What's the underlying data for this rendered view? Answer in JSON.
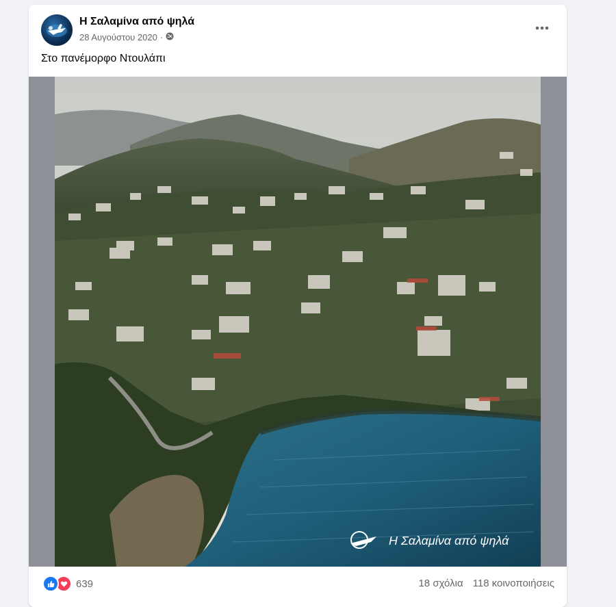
{
  "post": {
    "page_name": "Η Σαλαμίνα από ψηλά",
    "date": "28 Αυγούστου 2020",
    "privacy_separator": "·",
    "caption": "Στο πανέμορφο Ντουλάπι",
    "more_icon": "more-horizontal-icon",
    "privacy_icon": "globe-icon",
    "photo": {
      "watermark_text": "Η Σαλαμίνα από ψηλά"
    },
    "reactions": {
      "icons": [
        "like-icon",
        "love-icon"
      ],
      "count": "639"
    },
    "comments": "18 σχόλια",
    "shares": "118 κοινοποιήσεις"
  },
  "colors": {
    "background": "#f0f2f5",
    "card": "#ffffff",
    "like": "#1877f2",
    "love": "#f33e58",
    "secondary_text": "#65676b"
  }
}
